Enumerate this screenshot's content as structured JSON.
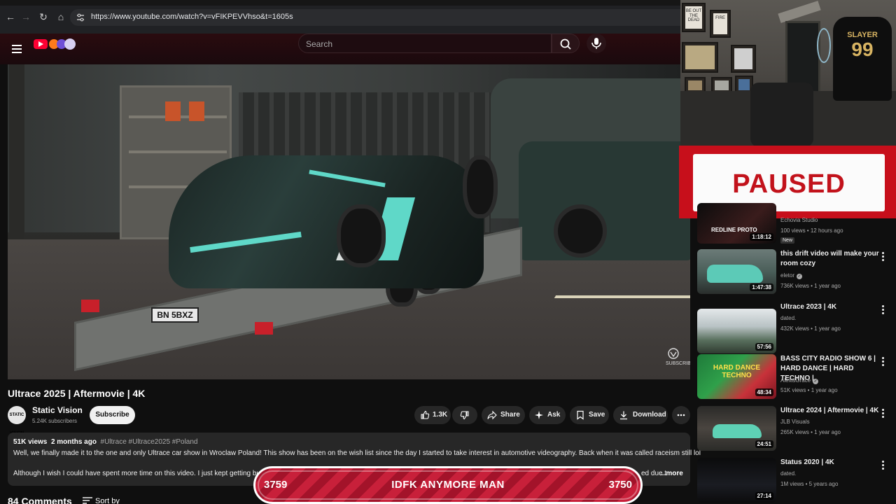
{
  "browser": {
    "url": "https://www.youtube.com/watch?v=vFIKPEVVhso&t=1605s"
  },
  "header": {
    "search_placeholder": "Search"
  },
  "video": {
    "title": "Ultrace 2025 | Aftermovie | 4K",
    "plate_text": "BN 5BXZ",
    "watermark": "SUBSCRIBE"
  },
  "channel": {
    "name": "Static Vision",
    "avatar_text": "STATIC VISION",
    "subscribers": "5.24K subscribers",
    "subscribe_label": "Subscribe"
  },
  "actions": {
    "likes": "1.3K",
    "share": "Share",
    "ask": "Ask",
    "save": "Save",
    "download": "Download"
  },
  "description": {
    "views": "51K views",
    "age": "2 months ago",
    "tags": "#Ultrace #Ultrace2025 #Poland",
    "line1": "Well, we finally made it to the one and only Ultrace car show in Wroclaw Poland! This show has been on the wish list since the day I started to take interest in automotive videography. Back when it was called raceism still lol",
    "line2": "Although I wish I could have spent more time on this video. I just kept getting busier",
    "line2_tail": "ed due t",
    "more": "...more"
  },
  "comments": {
    "count_label": "84 Comments",
    "sort_label": "Sort by"
  },
  "webcam": {
    "jersey_name": "SLAYER",
    "jersey_number": "99",
    "poster1": "BE OUT THE DEAD",
    "poster2": "FIRE"
  },
  "overlay": {
    "paused_label": "PAUSED"
  },
  "sidebar": {
    "items": [
      {
        "title": "",
        "channel": "Echovia Studio",
        "stats": "100 views • 12 hours ago",
        "badge": "New",
        "duration": "1:18:12",
        "thumb_text": "REDLINE PROTO"
      },
      {
        "title": "this drift video will make your room cozy",
        "channel": "eletor",
        "stats": "736K views • 1 year ago",
        "duration": "1:47:38"
      },
      {
        "title": "Ultrace 2023 | 4K",
        "channel": "dated.",
        "stats": "432K views • 1 year ago",
        "duration": "57:56"
      },
      {
        "title": "BASS CITY RADIO SHOW 6 | HARD DANCE | HARD TECHNO |",
        "channel": "AlexisGrace",
        "stats": "51K views • 1 year ago",
        "duration": "48:34",
        "thumb_text": "HARD DANCE TECHNO"
      },
      {
        "title": "Ultrace 2024 | Aftermovie | 4K",
        "channel": "JLB Visuals",
        "stats": "265K views • 1 year ago",
        "duration": "24:51"
      },
      {
        "title": "Status 2020 | 4K",
        "channel": "dated.",
        "stats": "1M views • 5 years ago",
        "duration": "27:14"
      }
    ]
  },
  "banner": {
    "left_count": "3759",
    "text": "IDFK ANYMORE MAN",
    "right_count": "3750"
  },
  "colors": {
    "yt_red": "#ff0033",
    "paused_red": "#c70f1b",
    "background": "#0f0f0f",
    "banner_red": "#c8203a"
  }
}
